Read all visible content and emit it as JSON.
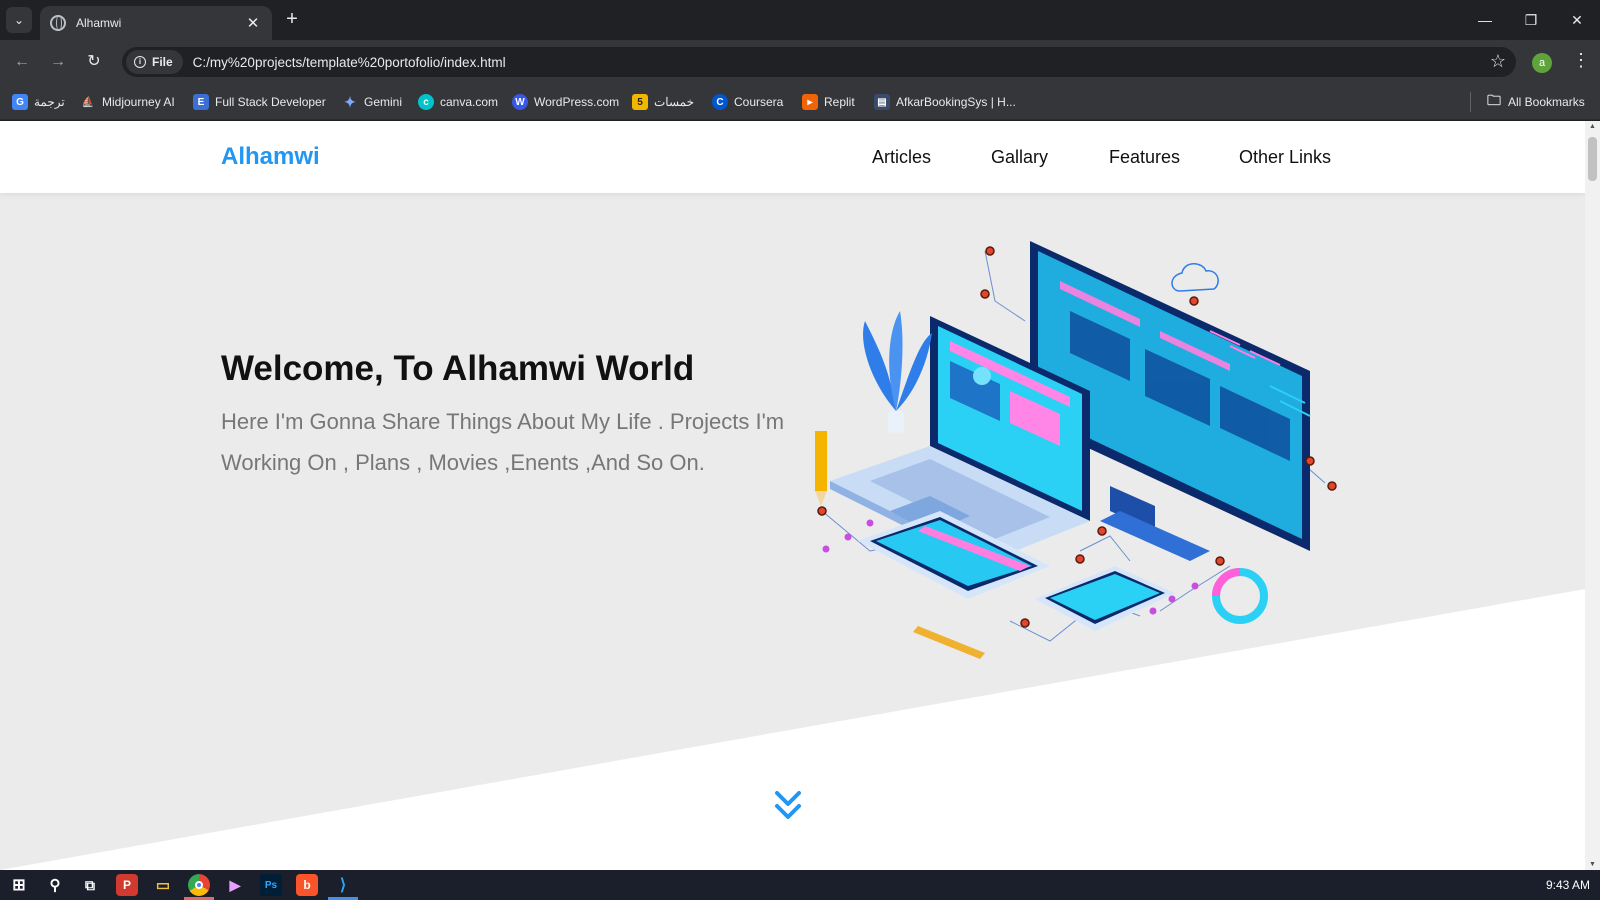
{
  "browser": {
    "tab_title": "Alhamwi",
    "url_chip": "File",
    "url": "C:/my%20projects/template%20portofolio/index.html",
    "profile_initial": "a",
    "bookmarks": [
      {
        "label": "ترجمة",
        "icon": "google-translate-icon",
        "color": "#4285f4"
      },
      {
        "label": "Midjourney AI",
        "icon": "midjourney-icon",
        "color": "#35363a"
      },
      {
        "label": "Full Stack Developer",
        "icon": "letter-e-icon",
        "color": "#3b6fd4"
      },
      {
        "label": "Gemini",
        "icon": "gemini-sparkle-icon",
        "color": "#35363a"
      },
      {
        "label": "canva.com",
        "icon": "canva-icon",
        "color": "#00c4cc"
      },
      {
        "label": "WordPress.com",
        "icon": "wordpress-icon",
        "color": "#3858e9"
      },
      {
        "label": "خمسات",
        "icon": "khamsat-icon",
        "color": "#f2b600"
      },
      {
        "label": "Coursera",
        "icon": "coursera-icon",
        "color": "#0056d2"
      },
      {
        "label": "Replit",
        "icon": "replit-icon",
        "color": "#f26207"
      },
      {
        "label": "AfkarBookingSys | H...",
        "icon": "afkar-icon",
        "color": "#3a4a6a"
      }
    ],
    "all_bookmarks": "All Bookmarks"
  },
  "site": {
    "logo": "Alhamwi",
    "brand_color": "#2196f3",
    "nav": [
      "Articles",
      "Gallary",
      "Features",
      "Other Links"
    ],
    "hero_title": "Welcome, To Alhamwi World",
    "hero_text": "Here I'm Gonna Share Things About My Life . Projects I'm Working On , Plans , Movies ,Enents ,And So On."
  },
  "taskbar": {
    "apps": [
      "windows-start-icon",
      "search-icon",
      "task-view-icon",
      "wps-icon",
      "file-explorer-icon",
      "chrome-icon",
      "media-player-icon",
      "photoshop-icon",
      "brave-icon",
      "vscode-icon"
    ],
    "clock": "9:43 AM"
  }
}
